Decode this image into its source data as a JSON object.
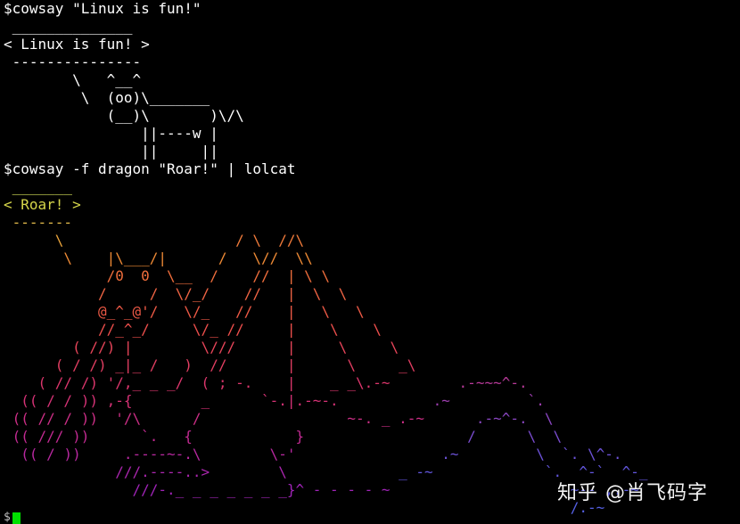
{
  "terminal": {
    "lines": [
      [
        {
          "t": "$cowsay \"Linux is fun!\"",
          "c": "#ffffff"
        }
      ],
      [
        {
          "t": " ______________",
          "c": "#ffffff"
        }
      ],
      [
        {
          "t": "< Linux is fun! >",
          "c": "#ffffff"
        }
      ],
      [
        {
          "t": " ---------------",
          "c": "#ffffff"
        }
      ],
      [
        {
          "t": "        \\   ^__^",
          "c": "#ffffff"
        }
      ],
      [
        {
          "t": "         \\  (oo)\\_______",
          "c": "#ffffff"
        }
      ],
      [
        {
          "t": "            (__)\\       )\\/\\",
          "c": "#ffffff"
        }
      ],
      [
        {
          "t": "                ||----w |",
          "c": "#ffffff"
        }
      ],
      [
        {
          "t": "                ||     ||",
          "c": "#ffffff"
        }
      ],
      [
        {
          "t": "$cowsay -f dragon \"Roar!\" | lolcat",
          "c": "#ffffff"
        }
      ],
      [
        {
          "t": " _______",
          "c": "#d4e05a"
        }
      ],
      [
        {
          "t": "< Roar! >",
          "c": "#d6d64a"
        }
      ],
      [
        {
          "t": " -------",
          "c": "#e0b84a"
        }
      ],
      [
        {
          "t": "      \\",
          "c": "#e8a23a"
        },
        {
          "t": "                    / \\  //\\",
          "c": "#ef7a3a"
        }
      ],
      [
        {
          "t": "       \\    |\\___/|      /   \\//  \\\\",
          "c": "#ee8a35"
        }
      ],
      [
        {
          "t": "            /0  0  \\__  /    //  | \\ \\",
          "c": "#f06e3c"
        }
      ],
      [
        {
          "t": "           /     /  \\/_/    //   |  \\  \\",
          "c": "#f06444"
        }
      ],
      [
        {
          "t": "           @_^_@'/   \\/_   //    |   \\   \\",
          "c": "#ef5a46"
        }
      ],
      [
        {
          "t": "           //_^_/     \\/_ //     |    \\    \\",
          "c": "#ee4f4c"
        }
      ],
      [
        {
          "t": "        ( //) |        \\///      |     \\     \\",
          "c": "#e8455a"
        }
      ],
      [
        {
          "t": "      ( / /) _|_ /   )  //       |      \\     _\\",
          "c": "#e23e62"
        }
      ],
      [
        {
          "t": "    ( // /) '/,_ _ _/  ( ; -.    |    _ _\\.-~",
          "c": "#dc366c"
        },
        {
          "t": "        .-~~~^-.",
          "c": "#b83a9a"
        }
      ],
      [
        {
          "t": "  (( / / )) ,-{        _      `-.|.-~-.",
          "c": "#d63276"
        },
        {
          "t": "           .~         `.",
          "c": "#9e3fb0"
        }
      ],
      [
        {
          "t": " (( // / ))  '/\\      /                 ~-. _ .-~",
          "c": "#cc2e86"
        },
        {
          "t": "      .-~^-.  \\",
          "c": "#8a46c2"
        }
      ],
      [
        {
          "t": " (( /// ))      `.   {            }",
          "c": "#c22a92"
        },
        {
          "t": "                   /      \\  \\",
          "c": "#7a4ccf"
        }
      ],
      [
        {
          "t": "  (( / ))     .----~-.\\        \\-'",
          "c": "#b828a0"
        },
        {
          "t": "                 .~         \\  `. \\^-.",
          "c": "#6c52d8"
        }
      ],
      [
        {
          "t": "             ///.----..>        \\",
          "c": "#aa26ae"
        },
        {
          "t": "             _ -~             `.  ^-`  ^-_",
          "c": "#6256de"
        }
      ],
      [
        {
          "t": "               ///-._ _ _ _ _ _ _}^ - - - - ~",
          "c": "#a024b8"
        },
        {
          "t": "                     ~-- ,.-~",
          "c": "#5a5ae2"
        }
      ],
      [
        {
          "t": "                                                                  /.-~",
          "c": "#5560e4"
        }
      ]
    ],
    "prompt": "$"
  },
  "watermark": {
    "text": "知乎 @肖飞码字"
  },
  "colors": {
    "background": "#000000",
    "cursor": "#00e000"
  }
}
